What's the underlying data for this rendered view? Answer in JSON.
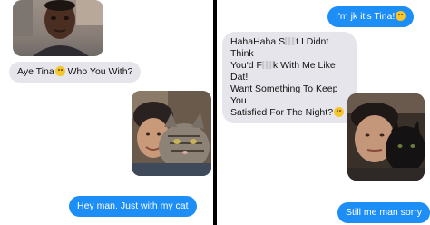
{
  "left_panel": {
    "incoming_message": {
      "before_emoji": "Aye Tina",
      "emoji": "smirk-emoji",
      "after_emoji": " Who You With?"
    },
    "outgoing_message": "Hey man. Just with my cat"
  },
  "right_panel": {
    "outgoing_message_1": {
      "text": "I'm jk it's Tina!",
      "emoji": "grin-emoji"
    },
    "incoming_message": {
      "line1_before": "HahaHaha S",
      "line1_after": "t I Didnt Think",
      "line2_before": "You'd F",
      "line2_after": "k With Me Like Dat!",
      "line3": "Want Something To Keep You",
      "line4": "Satisfied For The Night?",
      "emoji": "smirk-emoji"
    },
    "outgoing_message_2": "Still me man sorry"
  },
  "colors": {
    "blue_bubble": "#1e8ef7",
    "grey_bubble": "#e6e5eb",
    "divider": "#000000"
  }
}
